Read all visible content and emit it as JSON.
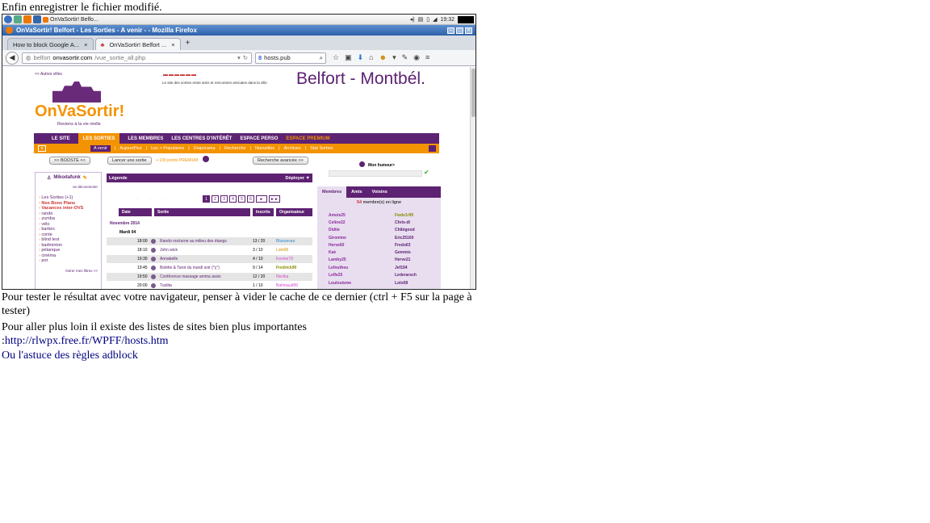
{
  "article": {
    "intro": "Enfin enregistrer le fichier modifié.",
    "p1": "Pour tester le résultat avec votre navigateur, penser à vider le cache de ce dernier (ctrl + F5 sur la page à tester)",
    "p2": "Pour aller plus loin il existe des listes de sites bien plus importantes",
    "p3_prefix": ":",
    "p3_link": "http://rlwpx.free.fr/WPFF/hosts.htm",
    "p4": "Ou l'astuce des règles adblock"
  },
  "screenshot": {
    "system_bar": {
      "task": "OnVaSortir! Belfo...",
      "clock": "19:32"
    },
    "window_title": "OnVaSortir! Belfort - Les Sorties - A venir - - Mozilla Firefox",
    "tabs": [
      {
        "label": "How to block Google A...",
        "close": "×"
      },
      {
        "label": "OnVaSortir! Belfort ...",
        "close": "×"
      }
    ],
    "tab_new": "+",
    "url_host": "belfort",
    "url_domain": "onvasortir.com",
    "url_path": "/vue_sortie_all.php",
    "search_value": "hosts.pub",
    "page": {
      "autres_villes": "<< Autres villes",
      "tagline": "Le site des sorties entre amis et rencontres amicales dans la ville",
      "city": "Belfort - Montbél.",
      "logo": "OnVaSortir!",
      "logo_sub": "Reviens à la vie réelle",
      "menu": [
        "LE SITE",
        "LES SORTIES",
        "LES MEMBRES",
        "LES CENTRES D'INTÉRÊT",
        "ESPACE PERSO",
        "ESPACE PREMIUM"
      ],
      "submenu": [
        "A venir",
        "Aujourd'hui",
        "Les + Populaires",
        "Diaporama",
        "Recherche",
        "Nouvelles",
        "Archives",
        "Stat Sorties"
      ],
      "boost": ">> BOOSTE <<",
      "lancer": "Lancer une sortie",
      "premium_points": "+ 100 points PREMIUM",
      "recherche_avancee": "Recherche avancée >>",
      "humeur": "Mon humeur>",
      "user": "Mikodafunk",
      "deconnecter": "se déconnecter",
      "left_links": [
        "Les Sorties (+1)",
        "Nos Bons Plans",
        "Vacances inter-OVS",
        "rando",
        "zumba",
        "vélo",
        "barbec",
        "conte",
        "blind test",
        "badminton",
        "pétanque",
        "cinéma",
        "pot"
      ],
      "gerer_filtres": "Gérer mes filtres >>",
      "legende": "Légende",
      "deployer": "Déployer ▼",
      "pager": [
        "1",
        "2",
        "3",
        "4",
        "5",
        "6",
        "►",
        "►►"
      ],
      "headers": [
        "Date",
        "Sortie",
        "Inscrits",
        "Organisateur"
      ],
      "month": "Novembre 2014",
      "day": "Mardi 04",
      "rows": [
        {
          "time": "18:00",
          "title": "Rando nocturne au milieu des étangs",
          "count": "13 / 20",
          "org": "Bluesevan"
        },
        {
          "time": "18:10",
          "title": "John wick",
          "count": "3 / 10",
          "org": "Lolo68"
        },
        {
          "time": "19:30",
          "title": "Annabelle",
          "count": "4 / 10",
          "org": "Kevine79"
        },
        {
          "time": "19:45",
          "title": "Bolétie & Tarot du mardi soir (°ç°)",
          "count": "9 / 14",
          "org": "Fredrick90"
        },
        {
          "time": "19:50",
          "title": "Conférence massage amma assis",
          "count": "12 / 20",
          "org": "Neclka"
        },
        {
          "time": "20:00",
          "title": "Tuolita",
          "count": "1 / 10",
          "org": "Bahmaud99"
        }
      ],
      "right_tabs": [
        "Membres",
        "Amis",
        "Voisins"
      ],
      "online_count": "54",
      "online_text": "membre(s) en ligne",
      "members_left": [
        "Amois25",
        "Celine22",
        "Didite",
        "Giromine",
        "Herve60",
        "Kaè",
        "Lamby25",
        "Lefoutheu",
        "Lelfe25",
        "Loulouisme"
      ],
      "members_right": [
        "Fwdv1r99",
        "Chris-dl",
        "Chibigood",
        "Eric25100",
        "Fredo63",
        "Gemmis",
        "Herve21",
        "Jef194",
        "Lederarsch",
        "Lolo08"
      ]
    }
  },
  "colors": {
    "purple": "#5d2272",
    "orange": "#f39300",
    "link": "#000080"
  }
}
